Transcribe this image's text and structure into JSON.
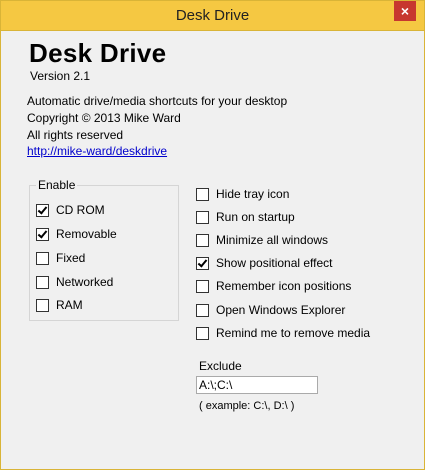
{
  "window": {
    "title": "Desk Drive",
    "close_glyph": "×"
  },
  "about": {
    "app_name": "Desk Drive",
    "version": "Version 2.1",
    "description": "Automatic drive/media shortcuts for your desktop",
    "copyright": "Copyright © 2013 Mike Ward",
    "rights": "All rights reserved",
    "link": "http://mike-ward/deskdrive"
  },
  "enable": {
    "label": "Enable",
    "items": [
      {
        "label": "CD ROM",
        "checked": true
      },
      {
        "label": "Removable",
        "checked": true
      },
      {
        "label": "Fixed",
        "checked": false
      },
      {
        "label": "Networked",
        "checked": false
      },
      {
        "label": "RAM",
        "checked": false
      }
    ]
  },
  "options": {
    "items": [
      {
        "label": "Hide tray icon",
        "checked": false
      },
      {
        "label": "Run on startup",
        "checked": false
      },
      {
        "label": "Minimize all windows",
        "checked": false
      },
      {
        "label": "Show positional effect",
        "checked": true
      },
      {
        "label": "Remember icon positions",
        "checked": false
      },
      {
        "label": "Open Windows Explorer",
        "checked": false
      },
      {
        "label": "Remind me to remove media",
        "checked": false
      }
    ]
  },
  "exclude": {
    "label": "Exclude",
    "value": "A:\\;C:\\",
    "example": "( example: C:\\, D:\\ )"
  },
  "colors": {
    "titlebar": "#f5c842",
    "close_button": "#c7372f",
    "link": "#0000cc"
  }
}
